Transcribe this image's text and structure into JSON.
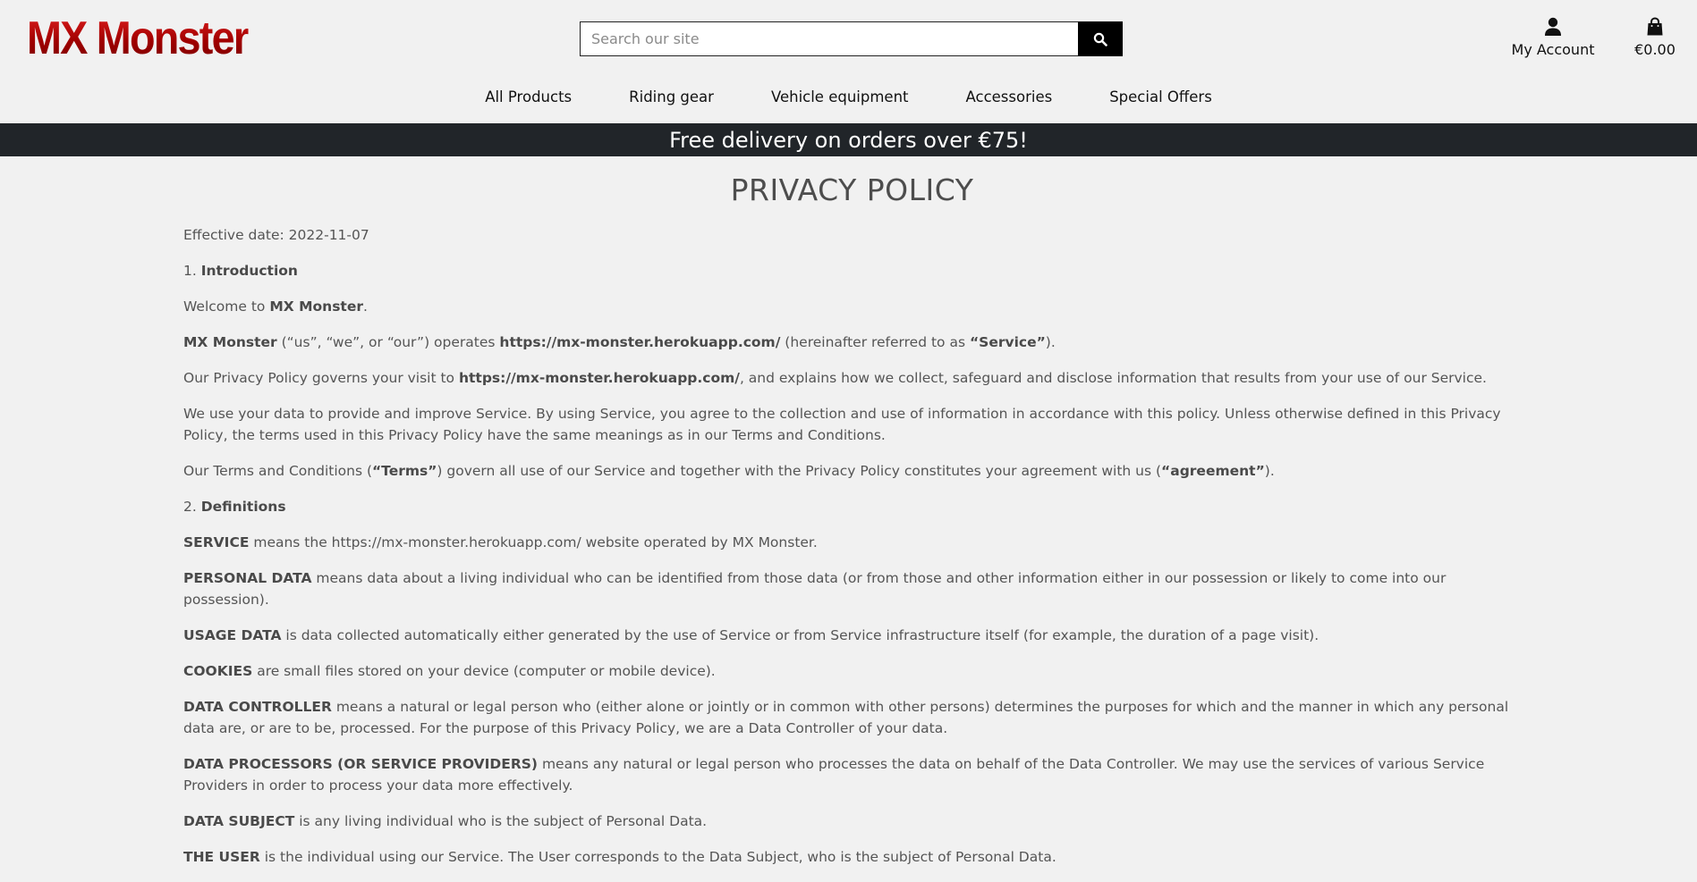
{
  "header": {
    "logo_text": "MX Monster",
    "search": {
      "placeholder": "Search our site",
      "button_icon": "search-icon"
    },
    "account": {
      "label": "My Account",
      "icon": "user-icon"
    },
    "cart": {
      "total": "€0.00",
      "icon": "shopping-bag-icon"
    }
  },
  "nav": {
    "items": [
      {
        "label": "All Products"
      },
      {
        "label": "Riding gear"
      },
      {
        "label": "Vehicle equipment"
      },
      {
        "label": "Accessories"
      },
      {
        "label": "Special Offers"
      }
    ]
  },
  "banner": {
    "text": "Free delivery on orders over €75!"
  },
  "policy": {
    "title": "PRIVACY POLICY",
    "effective": "Effective date: 2022-11-07",
    "intro_heading": {
      "num": "1. ",
      "title": "Introduction"
    },
    "welcome": {
      "pre": "Welcome to ",
      "name": "MX Monster",
      "post": "."
    },
    "operates": {
      "name": "MX Monster",
      "mid": " (“us”, “we”, or “our”) operates ",
      "url": "https://mx-monster.herokuapp.com/",
      "post": " (hereinafter referred to as ",
      "service": "“Service”",
      "end": ")."
    },
    "governs": {
      "pre": "Our Privacy Policy governs your visit to ",
      "url": "https://mx-monster.herokuapp.com/",
      "post": ", and explains how we collect, safeguard and disclose information that results from your use of our Service."
    },
    "use_data": "We use your data to provide and improve Service. By using Service, you agree to the collection and use of information in accordance with this policy. Unless otherwise defined in this Privacy Policy, the terms used in this Privacy Policy have the same meanings as in our Terms and Conditions.",
    "terms": {
      "pre": "Our Terms and Conditions (",
      "terms": "“Terms”",
      "mid": ") govern all use of our Service and together with the Privacy Policy constitutes your agreement with us (",
      "agreement": "“agreement”",
      "end": ")."
    },
    "defs_heading": {
      "num": "2. ",
      "title": "Definitions"
    },
    "definitions": [
      {
        "term": "SERVICE",
        "text": " means the https://mx-monster.herokuapp.com/ website operated by MX Monster."
      },
      {
        "term": "PERSONAL DATA",
        "text": " means data about a living individual who can be identified from those data (or from those and other information either in our possession or likely to come into our possession)."
      },
      {
        "term": "USAGE DATA",
        "text": " is data collected automatically either generated by the use of Service or from Service infrastructure itself (for example, the duration of a page visit)."
      },
      {
        "term": "COOKIES",
        "text": " are small files stored on your device (computer or mobile device)."
      },
      {
        "term": "DATA CONTROLLER",
        "text": " means a natural or legal person who (either alone or jointly or in common with other persons) determines the purposes for which and the manner in which any personal data are, or are to be, processed. For the purpose of this Privacy Policy, we are a Data Controller of your data."
      },
      {
        "term": "DATA PROCESSORS (OR SERVICE PROVIDERS)",
        "text": " means any natural or legal person who processes the data on behalf of the Data Controller. We may use the services of various Service Providers in order to process your data more effectively."
      },
      {
        "term": "DATA SUBJECT",
        "text": " is any living individual who is the subject of Personal Data."
      },
      {
        "term": "THE USER",
        "text": " is the individual using our Service. The User corresponds to the Data Subject, who is the subject of Personal Data."
      }
    ]
  },
  "colors": {
    "page_bg": "#f1f1f1",
    "banner_bg": "#212529",
    "logo_red": "#c41010",
    "text": "#555555"
  }
}
